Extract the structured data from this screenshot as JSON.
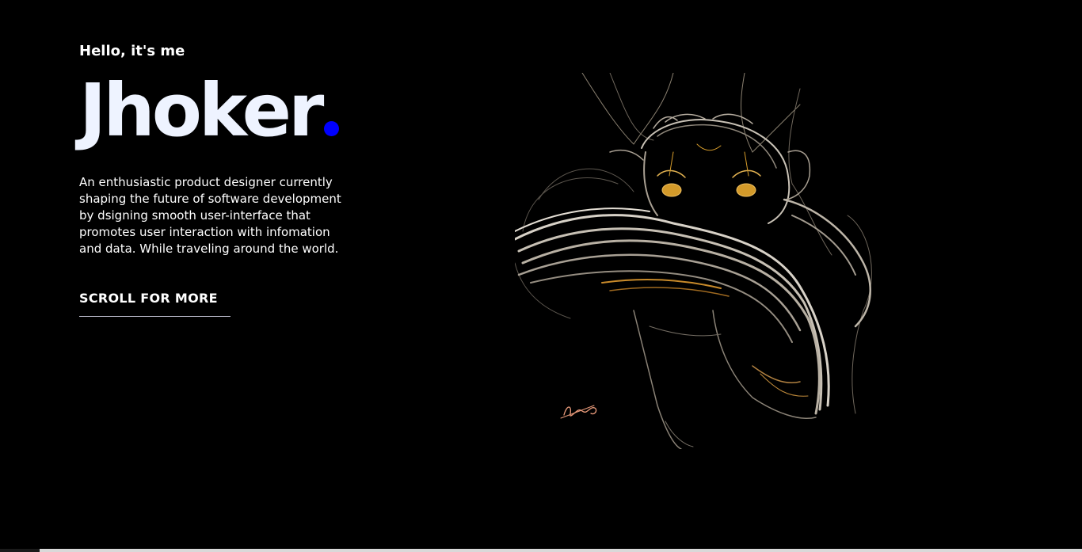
{
  "hero": {
    "greeting": "Hello, it's me",
    "name": "Jhoker",
    "name_dot_color": "#0000ff",
    "bio": "An enthusiastic product designer currently shaping the future of software development by dsigning smooth user-interface that promotes user interaction with infomation and data. While traveling around the world.",
    "cta_label": "SCROLL FOR MORE"
  },
  "artwork": {
    "subject": "line-drawing-creature-illustration",
    "signature": "Ahmed"
  },
  "colors": {
    "background": "#000000",
    "text": "#ffffff",
    "accent": "#0000ff"
  }
}
